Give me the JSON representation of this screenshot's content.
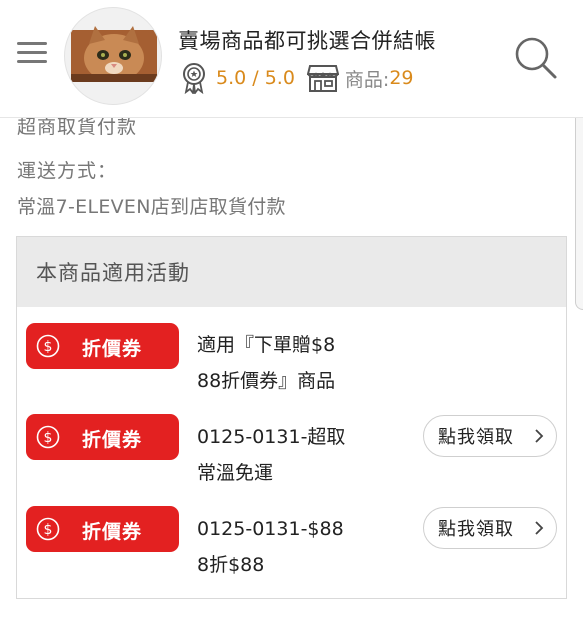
{
  "header": {
    "store_name": "賣場商品都可挑選合併結帳",
    "rating": "5.0 / 5.0",
    "goods_label": "商品:",
    "goods_count": "29"
  },
  "shipping": {
    "cut_text": "超商取貨付款",
    "label": "運送方式：",
    "value": "常溫7-ELEVEN店到店取貨付款"
  },
  "promotions": {
    "heading": "本商品適用活動",
    "items": [
      {
        "coupon_label": "折價券",
        "desc_line1": "適用『下單贈$8",
        "desc_line2": "88折價券』商品",
        "claim_label": ""
      },
      {
        "coupon_label": "折價券",
        "desc_line1": "0125-0131-超取",
        "desc_line2": "常溫免運",
        "claim_label": "點我領取"
      },
      {
        "coupon_label": "折價券",
        "desc_line1": "0125-0131-$88",
        "desc_line2": "8折$88",
        "claim_label": "點我領取"
      }
    ]
  },
  "colors": {
    "accent_orange": "#d98a1c",
    "coupon_red": "#e32121",
    "panel_header_bg": "#eaeaea"
  },
  "icons": {
    "menu": "hamburger-menu-icon",
    "rating": "award-ribbon-icon",
    "shop": "storefront-icon",
    "search": "search-icon",
    "coupon": "dollar-circle-icon",
    "claim": "chevron-right-icon"
  }
}
